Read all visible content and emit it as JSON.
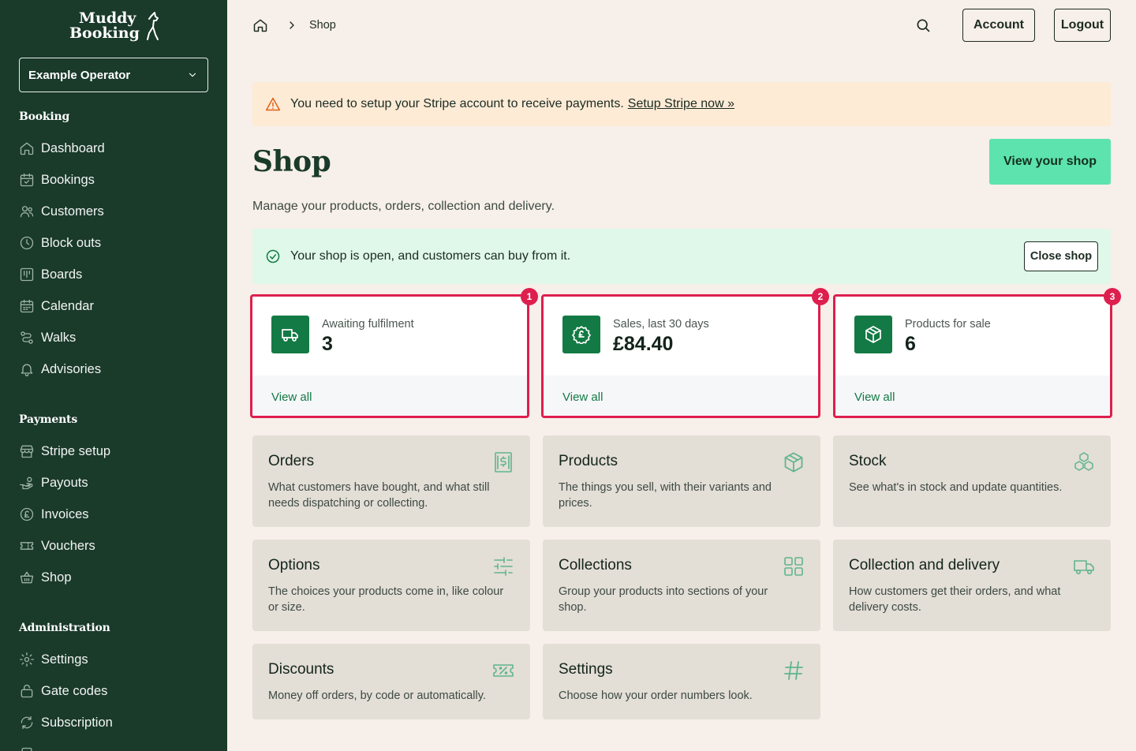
{
  "brand": {
    "line1": "Muddy",
    "line2": "Booking"
  },
  "operator": {
    "name": "Example Operator"
  },
  "sidebar": {
    "booking": {
      "title": "Booking",
      "items": [
        {
          "label": "Dashboard",
          "icon": "home-icon"
        },
        {
          "label": "Bookings",
          "icon": "calendar-check-icon"
        },
        {
          "label": "Customers",
          "icon": "users-icon"
        },
        {
          "label": "Block outs",
          "icon": "clock-icon"
        },
        {
          "label": "Boards",
          "icon": "board-icon"
        },
        {
          "label": "Calendar",
          "icon": "calendar-icon"
        },
        {
          "label": "Walks",
          "icon": "route-icon"
        },
        {
          "label": "Advisories",
          "icon": "bell-icon"
        }
      ]
    },
    "payments": {
      "title": "Payments",
      "items": [
        {
          "label": "Stripe setup",
          "icon": "store-icon"
        },
        {
          "label": "Payouts",
          "icon": "hand-coins-icon"
        },
        {
          "label": "Invoices",
          "icon": "pound-circle-icon"
        },
        {
          "label": "Vouchers",
          "icon": "ticket-icon"
        },
        {
          "label": "Shop",
          "icon": "basket-icon"
        }
      ]
    },
    "administration": {
      "title": "Administration",
      "items": [
        {
          "label": "Settings",
          "icon": "gear-icon"
        },
        {
          "label": "Gate codes",
          "icon": "lock-icon"
        },
        {
          "label": "Subscription",
          "icon": "refresh-icon"
        }
      ]
    }
  },
  "breadcrumb": {
    "current": "Shop"
  },
  "header": {
    "account": "Account",
    "logout": "Logout"
  },
  "stripe_alert": {
    "text": "You need to setup your Stripe account to receive payments.",
    "link": "Setup Stripe now »"
  },
  "page": {
    "title": "Shop",
    "subtitle": "Manage your products, orders, collection and delivery.",
    "view_shop": "View your shop"
  },
  "shop_status": {
    "text": "Your shop is open, and customers can buy from it.",
    "button": "Close shop"
  },
  "stats": [
    {
      "label": "Awaiting fulfilment",
      "value": "3",
      "link": "View all",
      "badge": "1",
      "icon": "truck-icon"
    },
    {
      "label": "Sales, last 30 days",
      "value": "£84.40",
      "link": "View all",
      "badge": "2",
      "icon": "pound-badge-icon"
    },
    {
      "label": "Products for sale",
      "value": "6",
      "link": "View all",
      "badge": "3",
      "icon": "box-icon"
    }
  ],
  "cards": [
    {
      "title": "Orders",
      "desc": "What customers have bought, and what still needs dispatching or collecting.",
      "icon": "receipt-icon"
    },
    {
      "title": "Products",
      "desc": "The things you sell, with their variants and prices.",
      "icon": "box-icon"
    },
    {
      "title": "Stock",
      "desc": "See what's in stock and update quantities.",
      "icon": "boxes-icon"
    },
    {
      "title": "Options",
      "desc": "The choices your products come in, like colour or size.",
      "icon": "sliders-icon"
    },
    {
      "title": "Collections",
      "desc": "Group your products into sections of your shop.",
      "icon": "grid-icon"
    },
    {
      "title": "Collection and delivery",
      "desc": "How customers get their orders, and what delivery costs.",
      "icon": "truck-icon"
    },
    {
      "title": "Discounts",
      "desc": "Money off orders, by code or automatically.",
      "icon": "discount-ticket-icon"
    },
    {
      "title": "Settings",
      "desc": "Choose how your order numbers look.",
      "icon": "hash-icon"
    }
  ],
  "colors": {
    "sidebar": "#1a3a2a",
    "background": "#f7efe9",
    "accent": "#5de3ad",
    "brand_green": "#137a45",
    "warning_bg": "#fdebd6",
    "success_bg": "#dff8e9",
    "highlight": "#dd1f4e",
    "card_bg": "#e3ded6"
  }
}
